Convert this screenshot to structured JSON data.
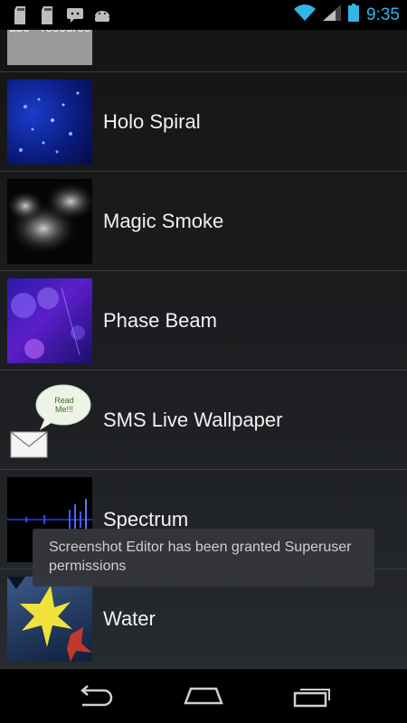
{
  "status_bar": {
    "time": "9:35",
    "notification_icons": [
      "sd-card-icon",
      "sd-card-icon",
      "message-icon",
      "android-icon"
    ],
    "accent": "#33b5e5"
  },
  "wallpapers": [
    {
      "label": "Cube - resource",
      "thumb_text": "ube - resource"
    },
    {
      "label": "Holo Spiral"
    },
    {
      "label": "Magic Smoke"
    },
    {
      "label": "Phase Beam"
    },
    {
      "label": "SMS Live Wallpaper",
      "thumb_text": "Read Me!!!"
    },
    {
      "label": "Spectrum"
    },
    {
      "label": "Water"
    }
  ],
  "toast": {
    "text": "Screenshot Editor has been granted Superuser permissions"
  },
  "nav": {
    "back": "back-icon",
    "home": "home-icon",
    "recents": "recent-apps-icon"
  }
}
